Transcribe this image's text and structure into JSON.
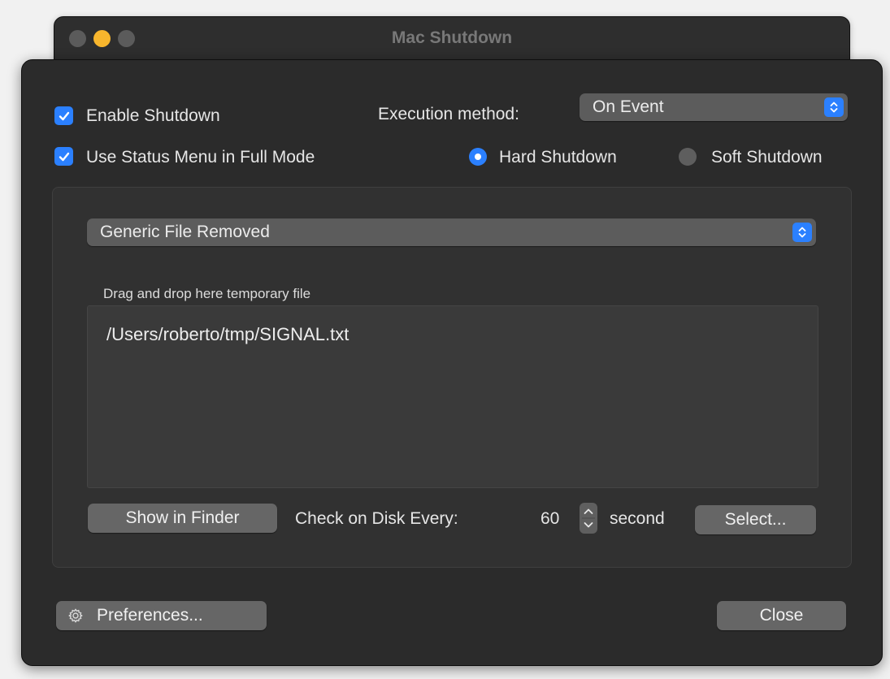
{
  "window": {
    "title": "Mac Shutdown"
  },
  "options": {
    "enable_shutdown_label": "Enable Shutdown",
    "enable_shutdown_checked": true,
    "status_menu_label": "Use Status Menu in Full Mode",
    "status_menu_checked": true,
    "execution_method_label": "Execution method:",
    "execution_method_value": "On Event",
    "hard_shutdown_label": "Hard Shutdown",
    "soft_shutdown_label": "Soft Shutdown",
    "selected_shutdown": "Hard Shutdown"
  },
  "event": {
    "type_value": "Generic File Removed",
    "drop_label": "Drag and drop here temporary file",
    "file_path": "/Users/roberto/tmp/SIGNAL.txt",
    "show_in_finder_label": "Show in Finder",
    "check_label": "Check on Disk Every:",
    "interval_value": "60",
    "interval_unit": "second",
    "select_label": "Select..."
  },
  "footer": {
    "preferences_label": "Preferences...",
    "close_label": "Close"
  },
  "colors": {
    "accent": "#2b80ff",
    "minimize": "#f8b62d",
    "background": "#2b2b2b"
  },
  "icons": [
    "checkmark-icon",
    "popup-chevrons-icon",
    "stepper-arrows-icon",
    "gear-icon"
  ]
}
